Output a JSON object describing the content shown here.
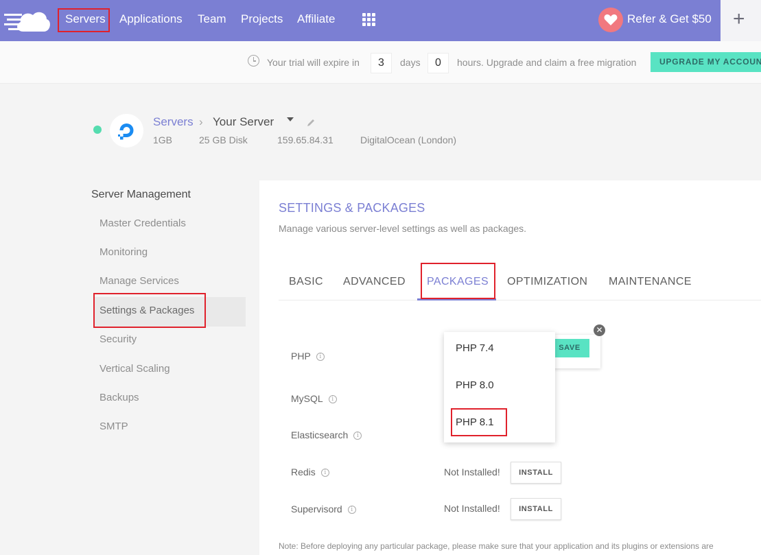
{
  "nav": {
    "items": [
      "Servers",
      "Applications",
      "Team",
      "Projects",
      "Affiliate"
    ],
    "refer_label": "Refer & Get $50",
    "plus_label": "+"
  },
  "trial": {
    "prefix": "Your trial will expire in",
    "days_value": "3",
    "days_label": "days",
    "hours_value": "0",
    "hours_label": "hours. Upgrade and claim a free migration",
    "upgrade_label": "UPGRADE MY ACCOUNT"
  },
  "server": {
    "breadcrumb_root": "Servers",
    "breadcrumb_sep": "›",
    "name": "Your Server",
    "size": "1GB",
    "disk": "25 GB Disk",
    "ip": "159.65.84.31",
    "provider": "DigitalOcean (London)",
    "status_color": "#55dcaf"
  },
  "sidebar": {
    "title": "Server Management",
    "items": [
      "Master Credentials",
      "Monitoring",
      "Manage Services",
      "Settings & Packages",
      "Security",
      "Vertical Scaling",
      "Backups",
      "SMTP"
    ],
    "active_index": 3
  },
  "panel": {
    "title": "SETTINGS & PACKAGES",
    "subtitle": "Manage various server-level settings as well as packages.",
    "tabs": [
      "BASIC",
      "ADVANCED",
      "PACKAGES",
      "OPTIMIZATION",
      "MAINTENANCE"
    ],
    "active_tab": "PACKAGES",
    "packages": [
      {
        "name": "PHP"
      },
      {
        "name": "MySQL"
      },
      {
        "name": "Elasticsearch"
      },
      {
        "name": "Redis",
        "status": "Not Installed!",
        "action": "INSTALL"
      },
      {
        "name": "Supervisord",
        "status": "Not Installed!",
        "action": "INSTALL"
      }
    ],
    "info_glyph": "i",
    "php_dropdown": {
      "options": [
        "PHP 7.4",
        "PHP 8.0",
        "PHP 8.1"
      ],
      "highlighted": "PHP 8.1",
      "save_label": "SAVE",
      "close_glyph": "✕"
    },
    "note": "Note: Before deploying any particular package, please make sure that your application and its plugins or extensions are"
  },
  "colors": {
    "brand": "#7b7fd3",
    "accent": "#59e3c3",
    "highlight_box": "#e0212b"
  }
}
